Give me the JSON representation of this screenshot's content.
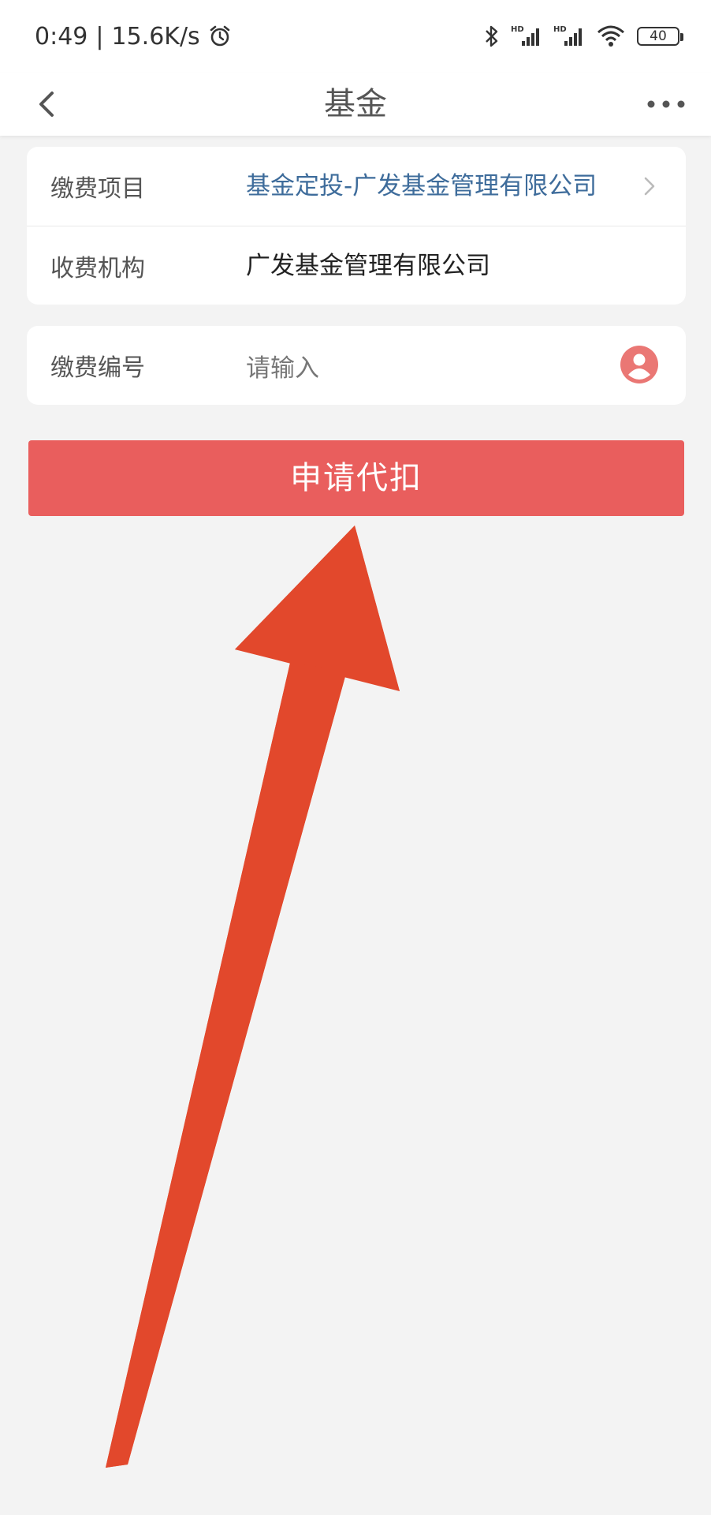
{
  "status_bar": {
    "time": "0:49",
    "separator": "|",
    "net_speed": "15.6K/s",
    "battery": "40",
    "icons": [
      "alarm-icon",
      "bluetooth-icon",
      "signal-hd-icon",
      "signal-hd-icon",
      "wifi-icon",
      "battery-icon"
    ]
  },
  "nav": {
    "title": "基金",
    "back_icon": "chevron-left-icon",
    "more_icon": "more-dots-icon"
  },
  "form": {
    "item_label": "缴费项目",
    "item_value": "基金定投-广发基金管理有限公司",
    "org_label": "收费机构",
    "org_value": "广发基金管理有限公司",
    "number_label": "缴费编号",
    "number_placeholder": "请输入"
  },
  "actions": {
    "apply_label": "申请代扣"
  },
  "colors": {
    "accent": "#e95e5d",
    "link": "#3e6c9b",
    "annotation_arrow": "#e2482c",
    "background": "#f3f3f3"
  }
}
